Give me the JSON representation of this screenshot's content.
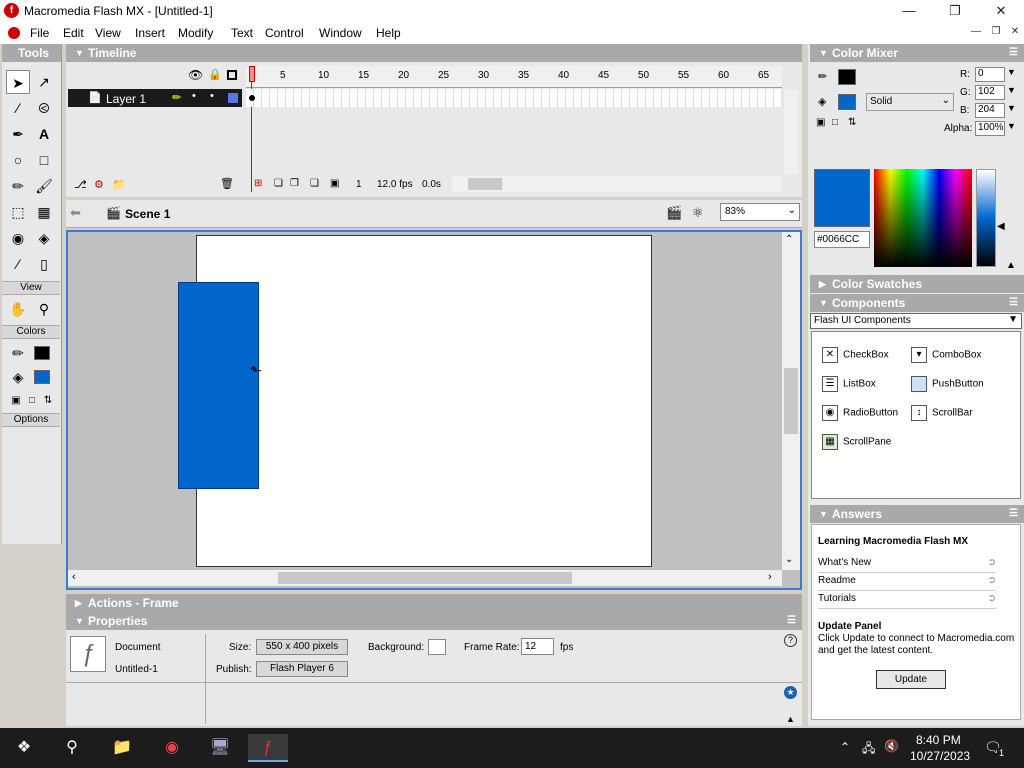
{
  "window": {
    "title": "Macromedia Flash MX - [Untitled-1]"
  },
  "menu": [
    "File",
    "Edit",
    "View",
    "Insert",
    "Modify",
    "Text",
    "Control",
    "Window",
    "Help"
  ],
  "tools": {
    "title": "Tools",
    "view_label": "View",
    "colors_label": "Colors",
    "options_label": "Options"
  },
  "timeline": {
    "title": "Timeline",
    "layer_name": "Layer 1",
    "ruler": [
      "5",
      "10",
      "15",
      "20",
      "25",
      "30",
      "35",
      "40",
      "45",
      "50",
      "55",
      "60",
      "65"
    ],
    "current_frame": "1",
    "fps": "12.0 fps",
    "elapsed": "0.0s"
  },
  "stage": {
    "scene": "Scene 1",
    "zoom": "83%",
    "shape_color": "#0066CC"
  },
  "panels": {
    "actions": "Actions - Frame",
    "properties": "Properties"
  },
  "properties": {
    "type": "Document",
    "name": "Untitled-1",
    "size_label": "Size:",
    "size_value": "550 x 400 pixels",
    "background_label": "Background:",
    "frame_rate_label": "Frame Rate:",
    "frame_rate_value": "12",
    "fps_unit": "fps",
    "publish_label": "Publish:",
    "publish_value": "Flash Player 6"
  },
  "color_mixer": {
    "title": "Color Mixer",
    "fill_type": "Solid",
    "r_label": "R:",
    "r": "0",
    "g_label": "G:",
    "g": "102",
    "b_label": "B:",
    "b": "204",
    "alpha_label": "Alpha:",
    "alpha": "100%",
    "hex": "#0066CC"
  },
  "color_swatches": {
    "title": "Color Swatches"
  },
  "components": {
    "title": "Components",
    "set": "Flash UI Components",
    "items": [
      "CheckBox",
      "ComboBox",
      "ListBox",
      "PushButton",
      "RadioButton",
      "ScrollBar",
      "ScrollPane"
    ]
  },
  "answers": {
    "title": "Answers",
    "heading": "Learning Macromedia Flash MX",
    "links": [
      "What's New",
      "Readme",
      "Tutorials"
    ],
    "update_heading": "Update Panel",
    "update_text": "Click Update to connect to Macromedia.com and get the latest content.",
    "update_button": "Update"
  },
  "taskbar": {
    "time": "8:40 PM",
    "date": "10/27/2023",
    "notif_count": "1"
  },
  "colors": {
    "accent": "#0066cc",
    "panel_header": "#a9a9a9"
  }
}
